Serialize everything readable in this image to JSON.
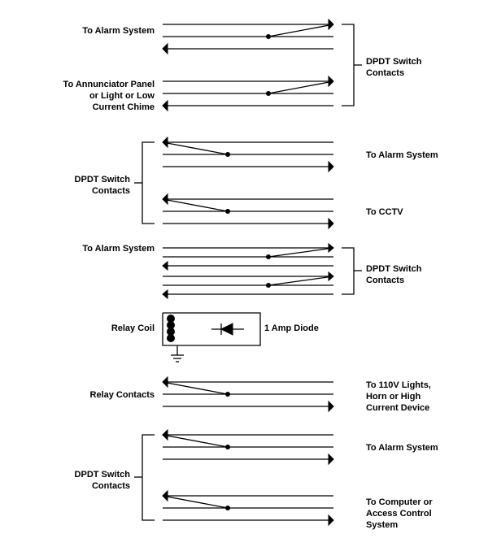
{
  "labels": {
    "block1": {
      "left_a": "To Alarm System",
      "left_b": "To Annunciator Panel\nor Light or Low\nCurrent Chime",
      "right": "DPDT Switch\nContacts"
    },
    "block2": {
      "left": "DPDT Switch\nContacts",
      "right_a": "To Alarm System",
      "right_b": "To CCTV"
    },
    "block3": {
      "left": "To Alarm System",
      "right": "DPDT Switch\nContacts"
    },
    "coil": {
      "left": "Relay Coil",
      "right": "1 Amp Diode"
    },
    "relay_contacts": {
      "left": "Relay Contacts",
      "right": "To 110V Lights,\nHorn or High\nCurrent Device"
    },
    "block4": {
      "left": "DPDT Switch\nContacts",
      "right_a": "To Alarm System",
      "right_b": "To Computer or\nAccess Control\nSystem"
    }
  }
}
